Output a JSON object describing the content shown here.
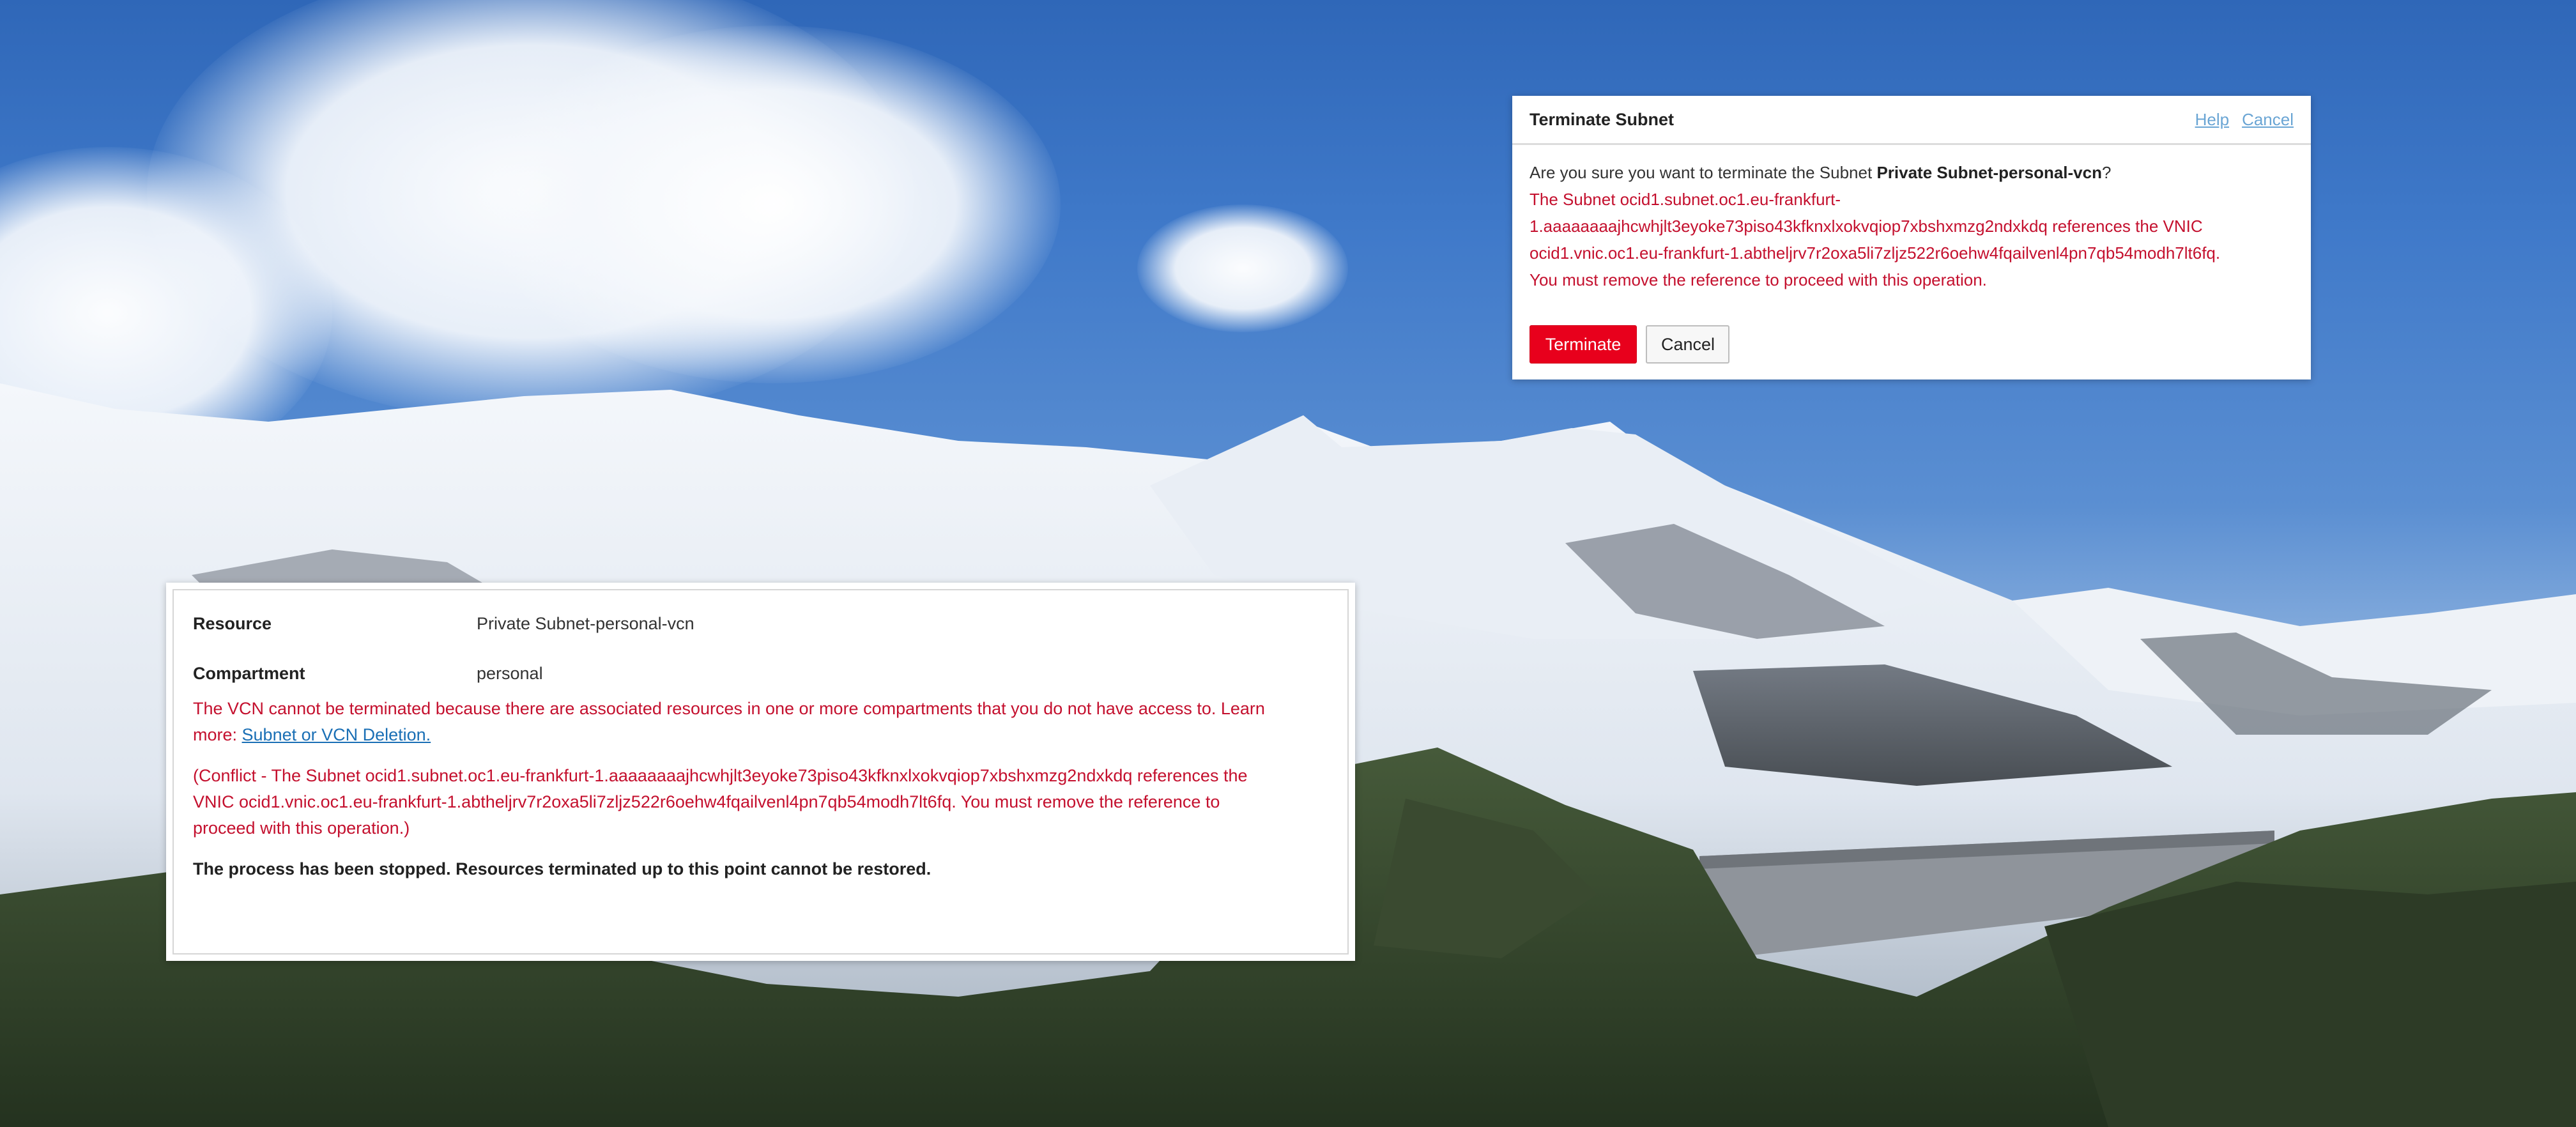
{
  "terminate_dialog": {
    "title": "Terminate Subnet",
    "help_link": "Help",
    "cancel_link": "Cancel",
    "question_prefix": "Are you sure you want to terminate the Subnet ",
    "subnet_name": "Private Subnet-personal-vcn",
    "question_suffix": "?",
    "error_line_1": "The Subnet ocid1.subnet.oc1.eu-frankfurt-",
    "error_line_2": "1.aaaaaaaajhcwhjlt3eyoke73piso43kfknxlxokvqiop7xbshxmzg2ndxkdq references the VNIC",
    "error_line_3": "ocid1.vnic.oc1.eu-frankfurt-1.abtheljrv7r2oxa5li7zljz522r6oehw4fqailvenl4pn7qb54modh7lt6fq.",
    "error_line_4": "You must remove the reference to proceed with this operation.",
    "terminate_button": "Terminate",
    "cancel_button": "Cancel"
  },
  "status_panel": {
    "resource_label": "Resource",
    "resource_value": "Private Subnet-personal-vcn",
    "compartment_label": "Compartment",
    "compartment_value": "personal",
    "vcn_error_line_1": "The VCN cannot be terminated because there are associated resources in one or more compartments that you do not have access to. Learn",
    "vcn_error_prefix": "more: ",
    "learn_more_link": "Subnet or VCN Deletion.",
    "conflict_line_1": "(Conflict - The Subnet ocid1.subnet.oc1.eu-frankfurt-1.aaaaaaaajhcwhjlt3eyoke73piso43kfknxlxokvqiop7xbshxmzg2ndxkdq references the",
    "conflict_line_2": "VNIC ocid1.vnic.oc1.eu-frankfurt-1.abtheljrv7r2oxa5li7zljz522r6oehw4fqailvenl4pn7qb54modh7lt6fq. You must remove the reference to",
    "conflict_line_3": "proceed with this operation.)",
    "final_message": "The process has been stopped. Resources terminated up to this point cannot be restored."
  },
  "colors": {
    "error_red": "#c4102e",
    "danger_button": "#e8001c",
    "link_blue": "#1a6fb5",
    "header_link": "#6aa5d4"
  }
}
